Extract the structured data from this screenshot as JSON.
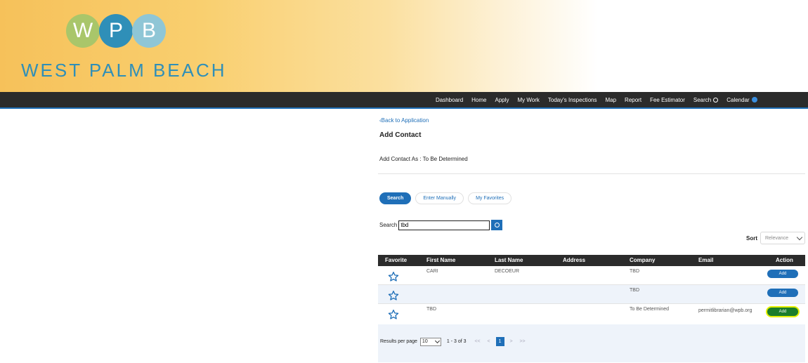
{
  "header": {
    "logo_letters": [
      "W",
      "P",
      "B"
    ],
    "city_name": "WEST PALM BEACH"
  },
  "nav": {
    "items": [
      "Dashboard",
      "Home",
      "Apply",
      "My Work",
      "Today's Inspections",
      "Map",
      "Report",
      "Fee Estimator",
      "Search",
      "Calendar"
    ]
  },
  "page": {
    "back_link": "‹Back to Application",
    "title": "Add Contact",
    "add_as": "Add Contact As : To Be Determined"
  },
  "tabs": [
    "Search",
    "Enter Manually",
    "My Favorites"
  ],
  "search": {
    "label": "Search",
    "value": "tbd"
  },
  "sort": {
    "label": "Sort",
    "selected": "Relevance"
  },
  "table": {
    "columns": [
      "Favorite",
      "First Name",
      "Last Name",
      "Address",
      "Company",
      "Email",
      "Action"
    ],
    "rows": [
      {
        "first": "CARI",
        "last": "DECOEUR",
        "address": "",
        "company": "TBD",
        "email": "",
        "action": "Add"
      },
      {
        "first": "",
        "last": "",
        "address": "",
        "company": "TBD",
        "email": "",
        "action": "Add"
      },
      {
        "first": "TBD",
        "last": "",
        "address": "",
        "company": "To Be Determined",
        "email": "permitlibrarian@wpb.org",
        "action": "Add"
      }
    ]
  },
  "pager": {
    "label": "Results per page",
    "per_page": "10",
    "range": "1 - 3 of 3",
    "first": "<<",
    "prev": "<",
    "current": "1",
    "next": ">",
    "last": ">>"
  },
  "colors": {
    "accent": "#1f6fb8",
    "navbar": "#2b2b2b",
    "banner_gold": "#f6c15a"
  }
}
